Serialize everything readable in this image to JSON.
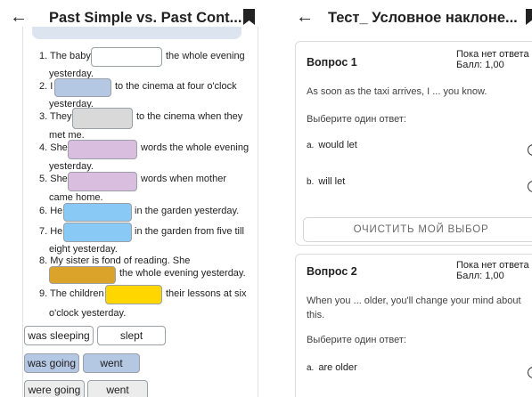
{
  "left": {
    "title": "Past Simple vs. Past Cont...",
    "questions": [
      {
        "num": "1. The baby",
        "after": "the whole evening",
        "cont": "yesterday."
      },
      {
        "num": "2. I",
        "after": "to the cinema at four o'clock",
        "cont": "yesterday."
      },
      {
        "num": "3. They",
        "after": "to the cinema when they",
        "cont": "met me."
      },
      {
        "num": "4. She",
        "after": "words the whole evening",
        "cont": "yesterday."
      },
      {
        "num": "5. She",
        "after": "words when mother",
        "cont": "came home."
      },
      {
        "num": "6. He",
        "after": "in the garden yesterday.",
        "cont": ""
      },
      {
        "num": "7. He",
        "after": "in the garden from five till",
        "cont": "eight yesterday."
      },
      {
        "num": "8. My sister is fond of reading. She",
        "after": "the whole evening yesterday.",
        "cont": ""
      },
      {
        "num": "9. The children",
        "after": "their lessons at six",
        "cont": "o'clock yesterday."
      }
    ],
    "answers": [
      {
        "a": "was sleeping",
        "b": "slept"
      },
      {
        "a": "was going",
        "b": "went"
      },
      {
        "a": "were going",
        "b": "went"
      }
    ]
  },
  "right": {
    "title": "Тест_ Условное наклоне...",
    "q1": {
      "heading": "Вопрос 1",
      "status": "Пока нет ответа",
      "score": "Балл: 1,00",
      "text": "As soon as the taxi arrives, I ... you know.",
      "prompt": "Выберите один ответ:",
      "options": [
        {
          "letter": "a.",
          "text": "would let"
        },
        {
          "letter": "b.",
          "text": "will let"
        }
      ],
      "clear": "ОЧИСТИТЬ МОЙ ВЫБОР"
    },
    "q2": {
      "heading": "Вопрос 2",
      "status": "Пока нет ответа",
      "score": "Балл: 1,00",
      "text": "When you ... older, you'll change your mind about this.",
      "prompt": "Выберите один ответ:",
      "options": [
        {
          "letter": "a.",
          "text": "are older"
        }
      ]
    }
  }
}
